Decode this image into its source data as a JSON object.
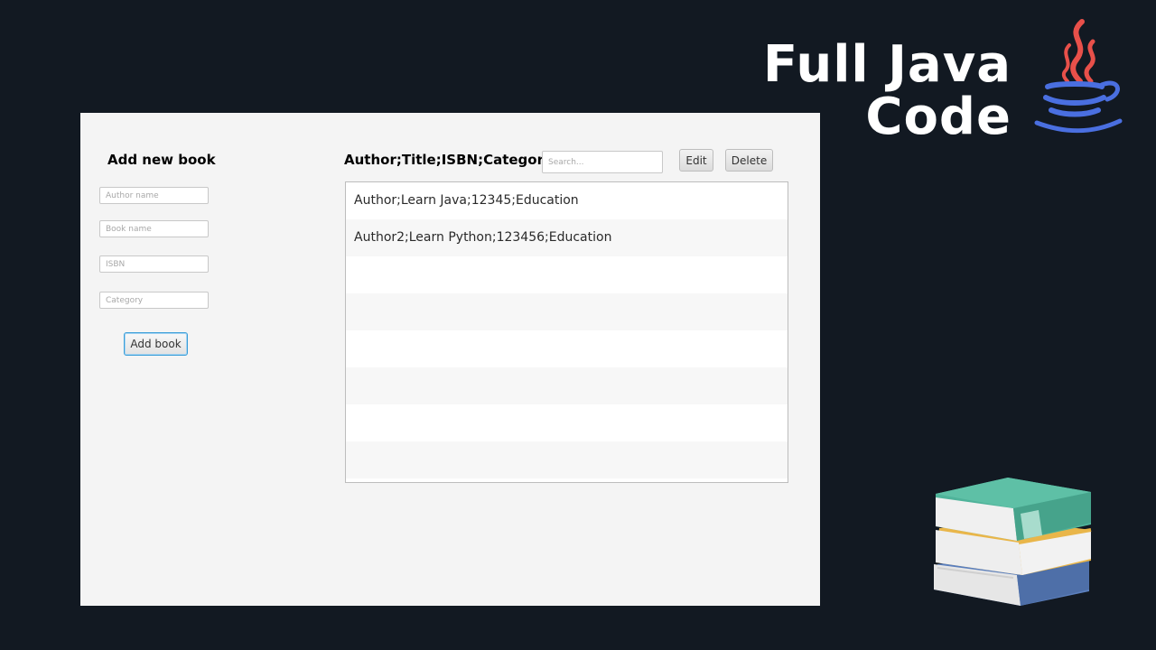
{
  "banner": {
    "line1": "Full Java",
    "line2": "Code"
  },
  "icons": {
    "java": "java-coffee-cup-logo",
    "books": "stacked-books-illustration"
  },
  "colors": {
    "background": "#121922",
    "window": "#f4f4f4",
    "accent_focus": "#3b9ed8",
    "java_steam": "#e8504a",
    "java_cup": "#4a6fe0"
  },
  "form": {
    "title": "Add new book",
    "fields": {
      "author": {
        "value": "",
        "placeholder": "Author name"
      },
      "book": {
        "value": "",
        "placeholder": "Book name"
      },
      "isbn": {
        "value": "",
        "placeholder": "ISBN"
      },
      "category": {
        "value": "",
        "placeholder": "Category"
      }
    },
    "add_button": "Add book"
  },
  "list": {
    "header": "Author;Title;ISBN;Category",
    "search": {
      "value": "",
      "placeholder": "Search..."
    },
    "edit_button": "Edit",
    "delete_button": "Delete",
    "items": [
      "Author;Learn Java;12345;Education",
      "Author2;Learn Python;123456;Education",
      "",
      "",
      "",
      "",
      "",
      ""
    ]
  }
}
